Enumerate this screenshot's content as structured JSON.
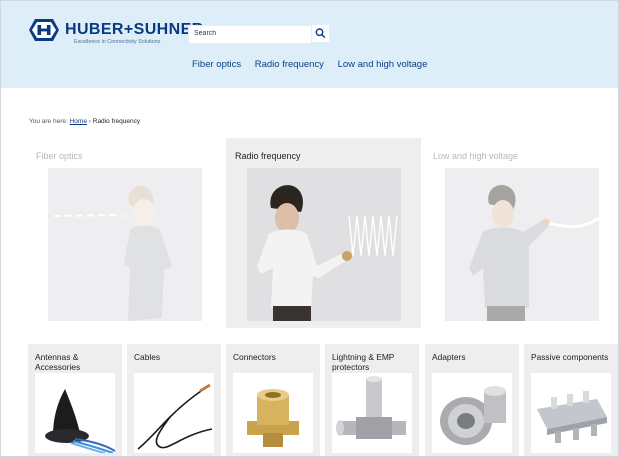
{
  "header": {
    "brand_name": "HUBER+SUHNER",
    "tagline": "Excellence in Connectivity Solutions",
    "colors": {
      "background": "#ddeef8",
      "brand": "#0b3a84"
    }
  },
  "search": {
    "placeholder": "Search",
    "button_icon": "search-icon"
  },
  "nav": {
    "items": [
      "Fiber optics",
      "Radio frequency",
      "Low and high voltage"
    ]
  },
  "breadcrumb": {
    "prefix": "You are here:",
    "home": "Home",
    "separator": "›",
    "current": "Radio frequency"
  },
  "categories": [
    {
      "title": "Fiber optics",
      "active": false
    },
    {
      "title": "Radio frequency",
      "active": true
    },
    {
      "title": "Low and high voltage",
      "active": false
    }
  ],
  "products": [
    {
      "title": "Antennas & Accessories",
      "icon": "antenna-icon"
    },
    {
      "title": "Cables",
      "icon": "cable-icon"
    },
    {
      "title": "Connectors",
      "icon": "connector-icon"
    },
    {
      "title": "Lightning & EMP protectors",
      "icon": "lightning-protector-icon"
    },
    {
      "title": "Adapters",
      "icon": "adapter-icon"
    },
    {
      "title": "Passive components",
      "icon": "splitter-icon"
    }
  ]
}
